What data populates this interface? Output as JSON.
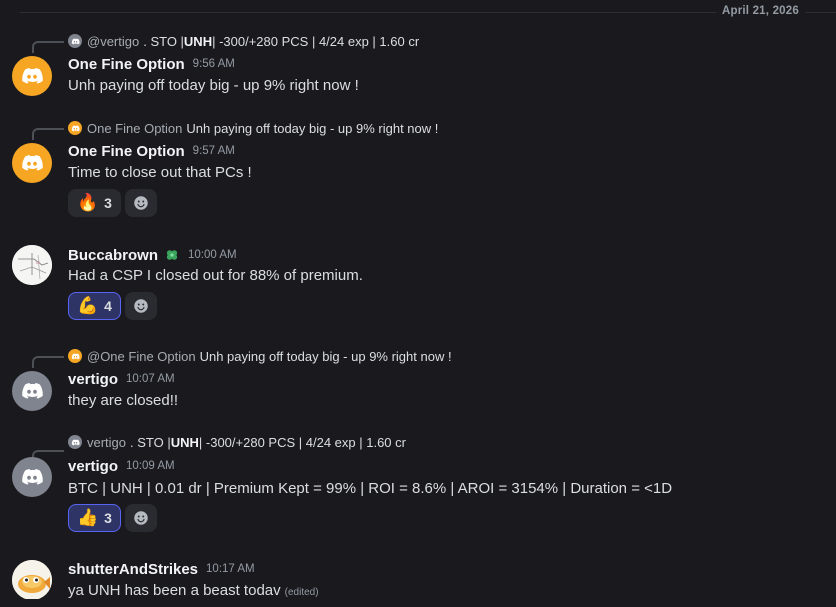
{
  "date_divider": "April 21, 2026",
  "colors": {
    "discord_orange": "#f6a623",
    "discord_gray": "#80848e",
    "accent": "#5865f2"
  },
  "messages": [
    {
      "reply": {
        "name": "@vertigo",
        "pre": " . STO | ",
        "bold": "UNH",
        "post": " | -300/+280 PCS | 4/24 exp | 1.60 cr"
      },
      "author": "One Fine Option",
      "time": "9:56 AM",
      "text": "Unh paying off today big - up 9% right now !"
    },
    {
      "reply": {
        "name": "One Fine Option",
        "text": "Unh paying off today big - up 9% right now !"
      },
      "author": "One Fine Option",
      "time": "9:57 AM",
      "text": "Time to close out that PCs !",
      "reactions": [
        {
          "emoji": "🔥",
          "icon": "fire-emoji",
          "count": "3"
        }
      ]
    },
    {
      "author": "Buccabrown",
      "time": "10:00 AM",
      "badge": "clover-badge-icon",
      "text": "Had a CSP I closed out for 88% of premium.",
      "reactions": [
        {
          "emoji": "💪",
          "icon": "flexed-biceps-emoji",
          "count": "4"
        }
      ]
    },
    {
      "reply": {
        "name": "@One Fine Option",
        "text": "Unh paying off today big - up 9% right now !"
      },
      "author": "vertigo",
      "time": "10:07 AM",
      "text": "they are closed!!"
    },
    {
      "reply": {
        "name": "vertigo",
        "pre": " . STO | ",
        "bold": "UNH",
        "post": " | -300/+280 PCS | 4/24 exp | 1.60 cr"
      },
      "author": "vertigo",
      "time": "10:09 AM",
      "text": "BTC | UNH | 0.01 dr | Premium Kept = 99% | ROI = 8.6% | AROI = 3154% | Duration = <1D",
      "reactions": [
        {
          "emoji": "👍",
          "icon": "thumbs-up-emoji",
          "count": "3"
        }
      ]
    },
    {
      "author": "shutterAndStrikes",
      "time": "10:17 AM",
      "text": "ya UNH has been a beast todav",
      "edited": "(edited)"
    }
  ]
}
